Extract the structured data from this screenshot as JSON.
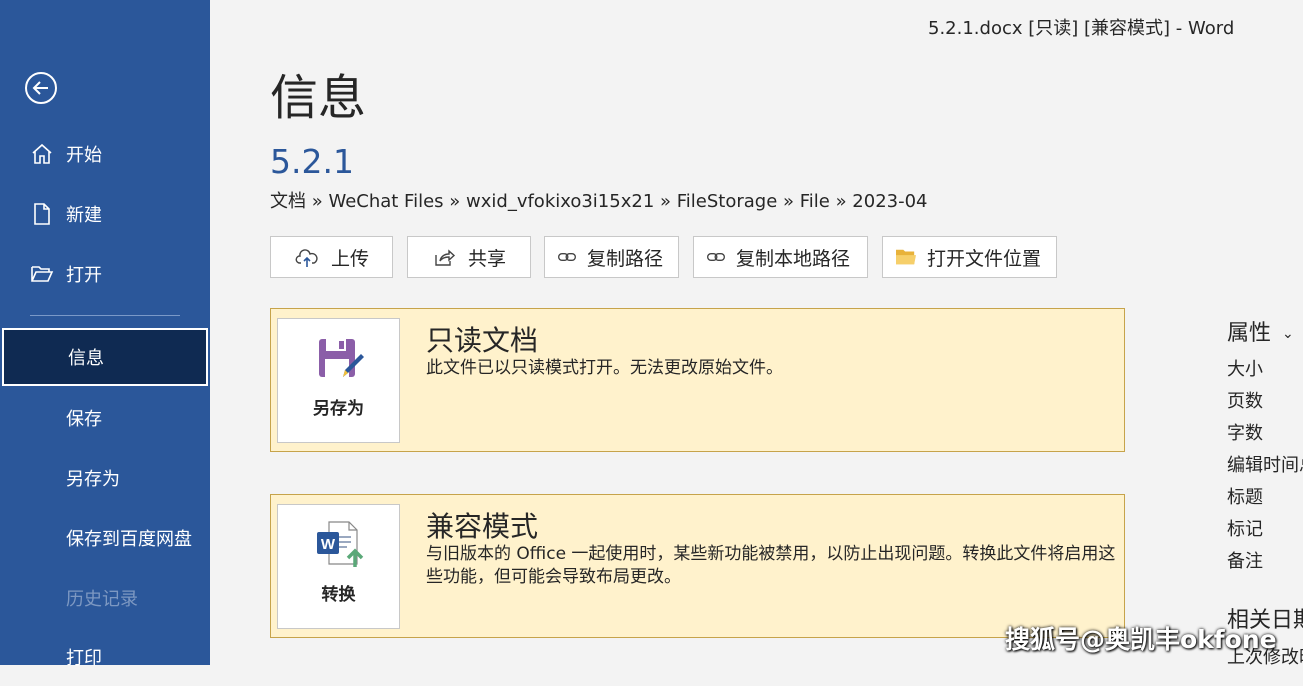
{
  "window": {
    "title": "5.2.1.docx [只读] [兼容模式]  -  Word"
  },
  "sidebar": {
    "items": [
      {
        "label": "开始",
        "icon": "home-icon"
      },
      {
        "label": "新建",
        "icon": "new-document-icon"
      },
      {
        "label": "打开",
        "icon": "open-folder-icon"
      },
      {
        "label": "信息",
        "state": "selected"
      },
      {
        "label": "保存"
      },
      {
        "label": "另存为"
      },
      {
        "label": "保存到百度网盘"
      },
      {
        "label": "历史记录",
        "state": "disabled"
      },
      {
        "label": "打印"
      }
    ]
  },
  "main": {
    "title": "信息",
    "doc_name": "5.2.1",
    "breadcrumb": "文档 » WeChat Files » wxid_vfokixo3i15x21 » FileStorage » File » 2023-04",
    "actions": [
      {
        "label": "上传",
        "icon": "cloud-upload-icon"
      },
      {
        "label": "共享",
        "icon": "share-icon"
      },
      {
        "label": "复制路径",
        "icon": "link-icon"
      },
      {
        "label": "复制本地路径",
        "icon": "link-icon"
      },
      {
        "label": "打开文件位置",
        "icon": "folder-icon"
      }
    ],
    "readonly_panel": {
      "tile_label": "另存为",
      "title": "只读文档",
      "desc": "此文件已以只读模式打开。无法更改原始文件。"
    },
    "compat_panel": {
      "tile_label": "转换",
      "title": "兼容模式",
      "desc": "与旧版本的 Office 一起使用时，某些新功能被禁用，以防止出现问题。转换此文件将启用这些功能，但可能会导致布局更改。"
    }
  },
  "properties": {
    "header": "属性",
    "labels": [
      "大小",
      "页数",
      "字数",
      "编辑时间总",
      "标题",
      "标记",
      "备注"
    ],
    "dates_header": "相关日期",
    "last_modified": "上次修改时"
  },
  "watermark": "搜狐号@奥凯丰okfone",
  "colors": {
    "sidebar": "#2b579a",
    "selected": "#0f2a52",
    "panel_bg": "#fff2cc",
    "panel_border": "#c6a34a"
  }
}
